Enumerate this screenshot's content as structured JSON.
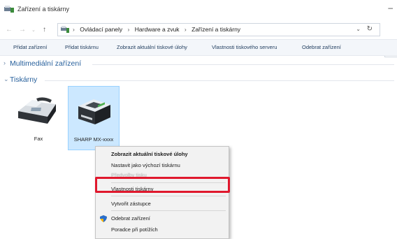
{
  "window": {
    "title": "Zařízení a tiskárny",
    "minimize_glyph": "–",
    "title_icon": "devices-printers-icon"
  },
  "address": {
    "breadcrumbs": [
      "Ovládací panely",
      "Hardware a zvuk",
      "Zařízení a tiskárny"
    ],
    "search_fragment": "P"
  },
  "commands": [
    "Přidat zařízení",
    "Přidat tiskárnu",
    "Zobrazit aktuální tiskové úlohy",
    "Vlastnosti tiskového serveru",
    "Odebrat zařízení"
  ],
  "groups": {
    "multimedia": {
      "label": "Multimediální zařízení",
      "expanded": false
    },
    "printers": {
      "label": "Tiskárny",
      "expanded": true
    }
  },
  "devices": [
    {
      "label": "Fax",
      "icon": "fax-icon",
      "selected": false
    },
    {
      "label": "SHARP MX-xxxx",
      "icon": "printer-icon",
      "selected": true
    }
  ],
  "context_menu": {
    "items": [
      {
        "label": "Zobrazit aktuální tiskové úlohy",
        "bold": true
      },
      {
        "label": "Nastavit jako výchozí tiskárnu"
      },
      {
        "label": "Předvolby tisku",
        "obscured": true
      },
      {
        "label": "Vlastnosti tiskárny",
        "highlighted": true
      },
      {
        "label": "Vytvořit zástupce"
      },
      {
        "label": "Odebrat zařízení",
        "icon": "shield-icon"
      },
      {
        "label": "Poradce při potížích"
      }
    ]
  },
  "colors": {
    "accent": "#27609c",
    "selection": "#cce8ff",
    "highlight_box": "#e0182d"
  }
}
